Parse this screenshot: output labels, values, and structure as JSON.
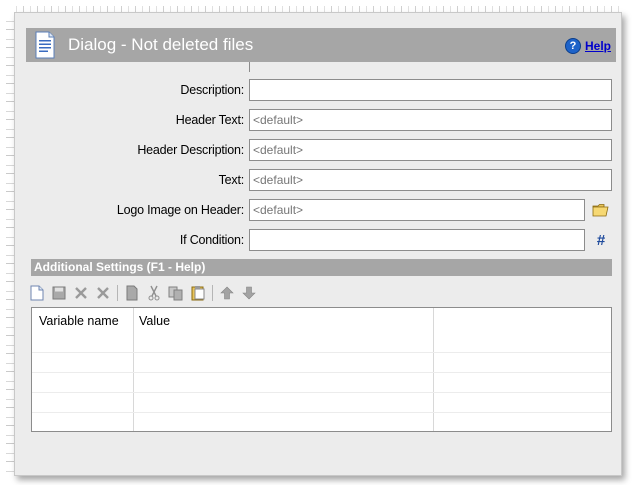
{
  "window": {
    "title": "Dialog - Not deleted files",
    "help_label": "Help",
    "help_icon": "help-circle-icon",
    "header_color": "#a6a6a6"
  },
  "form": {
    "fields": [
      {
        "label": "Description:",
        "value": "",
        "placeholder": ""
      },
      {
        "label": "Header Text:",
        "value": "",
        "placeholder": "<default>"
      },
      {
        "label": "Header Description:",
        "value": "",
        "placeholder": "<default>"
      },
      {
        "label": "Text:",
        "value": "",
        "placeholder": "<default>"
      },
      {
        "label": "Logo Image on Header:",
        "value": "",
        "placeholder": "<default>",
        "button_icon": "folder-open-icon"
      },
      {
        "label": "If Condition:",
        "value": "",
        "placeholder": "",
        "button_label": "#"
      }
    ]
  },
  "additional_settings": {
    "title": "Additional Settings (F1 - Help)",
    "toolbar_icons": [
      "new-icon",
      "save-icon",
      "delete-icon",
      "clear-icon",
      "copy-icon",
      "cut-icon",
      "duplicate-icon",
      "paste-icon",
      "move-up-icon",
      "move-down-icon"
    ],
    "table": {
      "columns": [
        "Variable name",
        "Value"
      ],
      "rows": []
    }
  }
}
